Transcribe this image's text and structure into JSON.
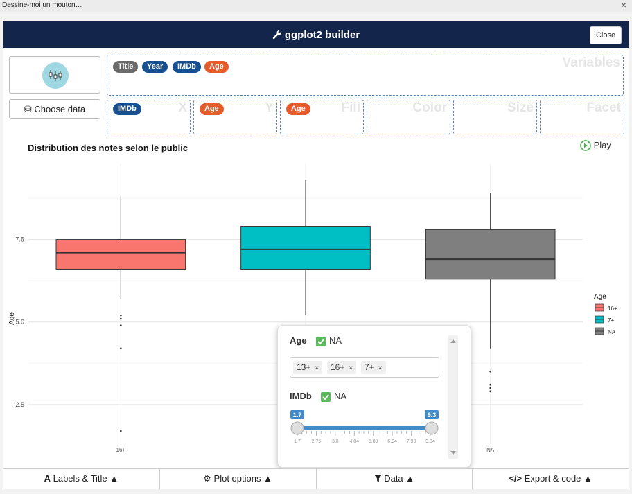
{
  "window": {
    "title": "Dessine-moi un mouton…",
    "close_glyph": "×"
  },
  "header": {
    "title": "ggplot2 builder",
    "close_label": "Close",
    "icon": "wrench-icon"
  },
  "sidebar": {
    "choose_data_label": "Choose data",
    "geom_icon": "boxplot-icon"
  },
  "variables": {
    "zone_label": "Variables",
    "items": [
      {
        "label": "Title",
        "color": "#6b6b6b"
      },
      {
        "label": "Year",
        "color": "#174f8f"
      },
      {
        "label": "IMDb",
        "color": "#174f8f"
      },
      {
        "label": "Age",
        "color": "#e55b2b"
      }
    ]
  },
  "mappings": {
    "x": {
      "label": "X",
      "value": "IMDb"
    },
    "y": {
      "label": "Y",
      "value": "Age"
    },
    "fill": {
      "label": "Fill",
      "value": "Age"
    },
    "color": {
      "label": "Color",
      "value": ""
    },
    "size": {
      "label": "Size",
      "value": ""
    },
    "facet": {
      "label": "Facet",
      "value": ""
    }
  },
  "plot": {
    "title": "Distribution des notes selon le public",
    "play_label": "Play"
  },
  "chart_data": {
    "type": "boxplot",
    "orientation": "vertical",
    "title": "Distribution des notes selon le public",
    "xlabel": "",
    "ylabel": "Age",
    "categories": [
      "16+",
      "",
      "NA"
    ],
    "y_ticks": [
      "7.5",
      "5.0",
      "2.5"
    ],
    "y_tick_values": [
      7.5,
      5.0,
      2.5
    ],
    "ylim": [
      1.3,
      9.8
    ],
    "grid": true,
    "series": [
      {
        "name": "16+",
        "color": "#f8766d",
        "whisker_low": 5.7,
        "q1": 6.6,
        "median": 7.1,
        "q3": 7.5,
        "whisker_high": 8.8,
        "outliers": [
          5.2,
          5.1,
          4.9,
          4.2,
          1.7
        ]
      },
      {
        "name": "7+",
        "color": "#00bfc4",
        "whisker_low": 5.2,
        "q1": 6.6,
        "median": 7.2,
        "q3": 7.9,
        "whisker_high": 9.3,
        "outliers": []
      },
      {
        "name": "NA",
        "color": "#7f7f7f",
        "whisker_low": 4.2,
        "q1": 6.3,
        "median": 6.9,
        "q3": 7.8,
        "whisker_high": 8.9,
        "outliers": [
          3.5,
          3.1,
          3.0,
          2.9
        ]
      }
    ],
    "legend": {
      "title": "Age",
      "position": "right",
      "entries": [
        "16+",
        "7+",
        "NA"
      ]
    }
  },
  "filter": {
    "age": {
      "label": "Age",
      "na_label": "NA",
      "na_checked": true,
      "selected": [
        "13+",
        "16+",
        "7+"
      ],
      "remove_glyph": "×"
    },
    "imdb": {
      "label": "IMDb",
      "na_label": "NA",
      "na_checked": true,
      "min": 1.7,
      "max": 9.3,
      "from": 1.7,
      "to": 9.3,
      "from_label": "1.7",
      "to_label": "9.3",
      "ticks": [
        "1.7",
        "2.75",
        "3.8",
        "4.84",
        "5.89",
        "6.94",
        "7.99",
        "9.04"
      ]
    }
  },
  "bottom": {
    "labels": "Labels & Title",
    "plot_options": "Plot options",
    "data": "Data",
    "export": "Export & code"
  }
}
